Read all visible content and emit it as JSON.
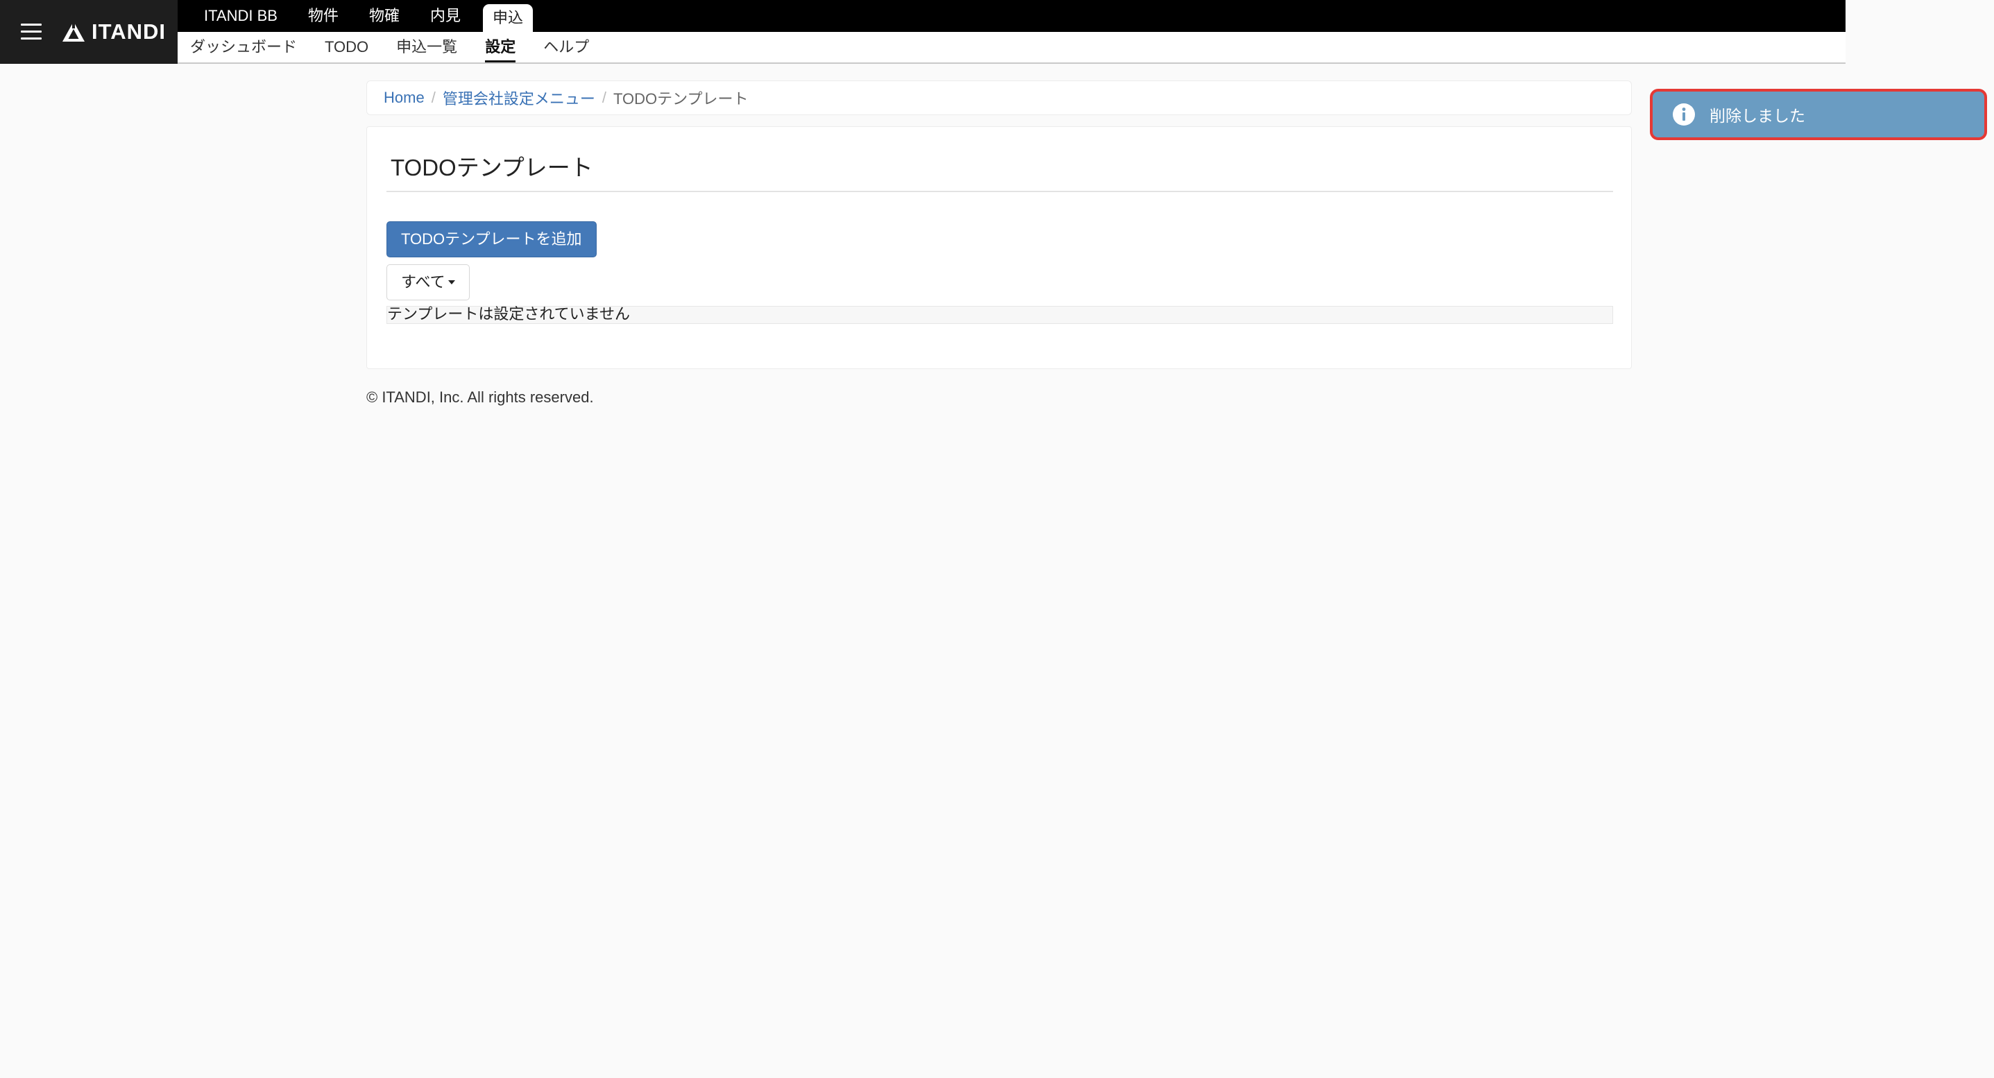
{
  "header": {
    "brand": "ITANDI",
    "top_nav": [
      "ITANDI BB",
      "物件",
      "物確",
      "内見",
      "申込"
    ],
    "top_nav_active": "申込",
    "sub_nav": [
      "ダッシュボード",
      "TODO",
      "申込一覧",
      "設定",
      "ヘルプ"
    ],
    "sub_nav_active": "設定"
  },
  "breadcrumb": {
    "home": "Home",
    "menu": "管理会社設定メニュー",
    "current": "TODOテンプレート"
  },
  "main": {
    "title": "TODOテンプレート",
    "add_button": "TODOテンプレートを追加",
    "filter_label": "すべて",
    "empty_message": "テンプレートは設定されていません"
  },
  "footer": {
    "copyright": "© ITANDI, Inc. All rights reserved."
  },
  "toast": {
    "message": "削除しました"
  },
  "colors": {
    "header_bg": "#000000",
    "brand_bg": "#1e1e1e",
    "primary": "#4479b8",
    "link": "#3a72b5",
    "toast_bg": "#6a9cc2",
    "toast_border": "#e53935",
    "page_bg": "#fafafa"
  },
  "icons": {
    "menu": "hamburger-menu-icon",
    "logo": "itandi-logo-icon",
    "caret": "caret-down-icon",
    "info": "info-icon"
  }
}
